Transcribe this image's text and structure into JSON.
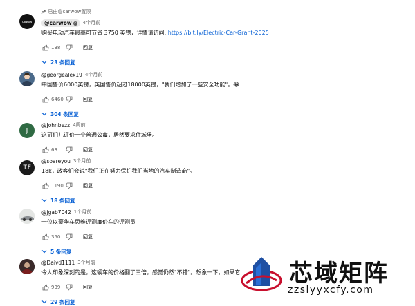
{
  "comments": [
    {
      "pinned_label": "已由@carwow置顶",
      "avatar_text": "carwow",
      "author": "@carwow",
      "time": "4个月前",
      "text": "购买电动汽车最高可节省 3750 英镑，详情请访问: ",
      "link": "https://bit.ly/Electric-Car-Grant-2025",
      "likes": "138",
      "reply_label": "回复",
      "replies_label": "23 条回复"
    },
    {
      "author": "@georgealex19",
      "time": "4个月前",
      "text": "中国售价6000英镑，英国售价超过18000英镑，\"我们增加了一些安全功能\"。😂",
      "likes": "6460",
      "reply_label": "回复",
      "replies_label": "304 条回复"
    },
    {
      "avatar_text": "J",
      "author": "@Johnbezz",
      "time": "4周前",
      "text": "这哥们儿评价一个普通公寓，居然要求住城堡。",
      "likes": "63",
      "reply_label": "回复"
    },
    {
      "avatar_text": "T.F",
      "author": "@soareyou",
      "time": "3个月前",
      "text": "18k，政客们会说\"我们正在努力保护我们当地的汽车制造商\"。",
      "likes": "1190",
      "reply_label": "回复",
      "replies_label": "18 条回复"
    },
    {
      "author": "@jgab7042",
      "time": "1个月前",
      "text": "一位以豪华车思维评测廉价车的评测员",
      "likes": "350",
      "reply_label": "回复",
      "replies_label": "5 条回复"
    },
    {
      "author": "@Daivd1111",
      "time": "3个月前",
      "text": "令人印象深刻的是，这辆车的价格翻了三倍，感觉仍然\"不错\"。想象一下，如果它",
      "likes": "939",
      "reply_label": "回复",
      "replies_label": "29 条回复"
    }
  ],
  "watermark": {
    "title": "芯域矩阵",
    "url": "zzslyyxcfy.com"
  },
  "colors": {
    "link": "#065fd4",
    "muted": "#606060",
    "text": "#0f0f0f"
  }
}
